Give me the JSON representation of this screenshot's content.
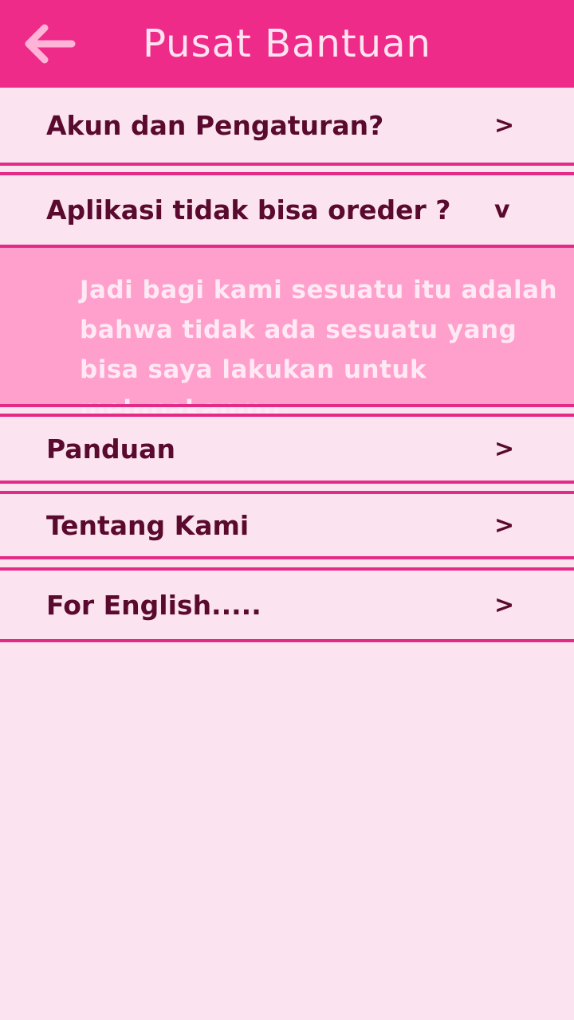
{
  "header": {
    "title": "Pusat Bantuan",
    "back_icon": "back-arrow-icon"
  },
  "colors": {
    "header_bg": "#ee2b88",
    "page_bg": "#fbe4ef",
    "divider": "#e22a86",
    "answer_bg": "#ff9fcc",
    "text_dark": "#5a0a2e",
    "text_light": "#ffe9f4"
  },
  "items": [
    {
      "label": "Akun dan Pengaturan?",
      "chevron": ">"
    },
    {
      "label": "Aplikasi tidak bisa oreder ?",
      "chevron": "v",
      "answer": "Jadi bagi kami sesuatu itu adalah bahwa tidak ada sesuatu yang bisa saya lakukan untuk melupakanmu."
    },
    {
      "label": "Panduan",
      "chevron": ">"
    },
    {
      "label": "Tentang Kami",
      "chevron": ">"
    },
    {
      "label": "For English.....",
      "chevron": ">"
    }
  ]
}
